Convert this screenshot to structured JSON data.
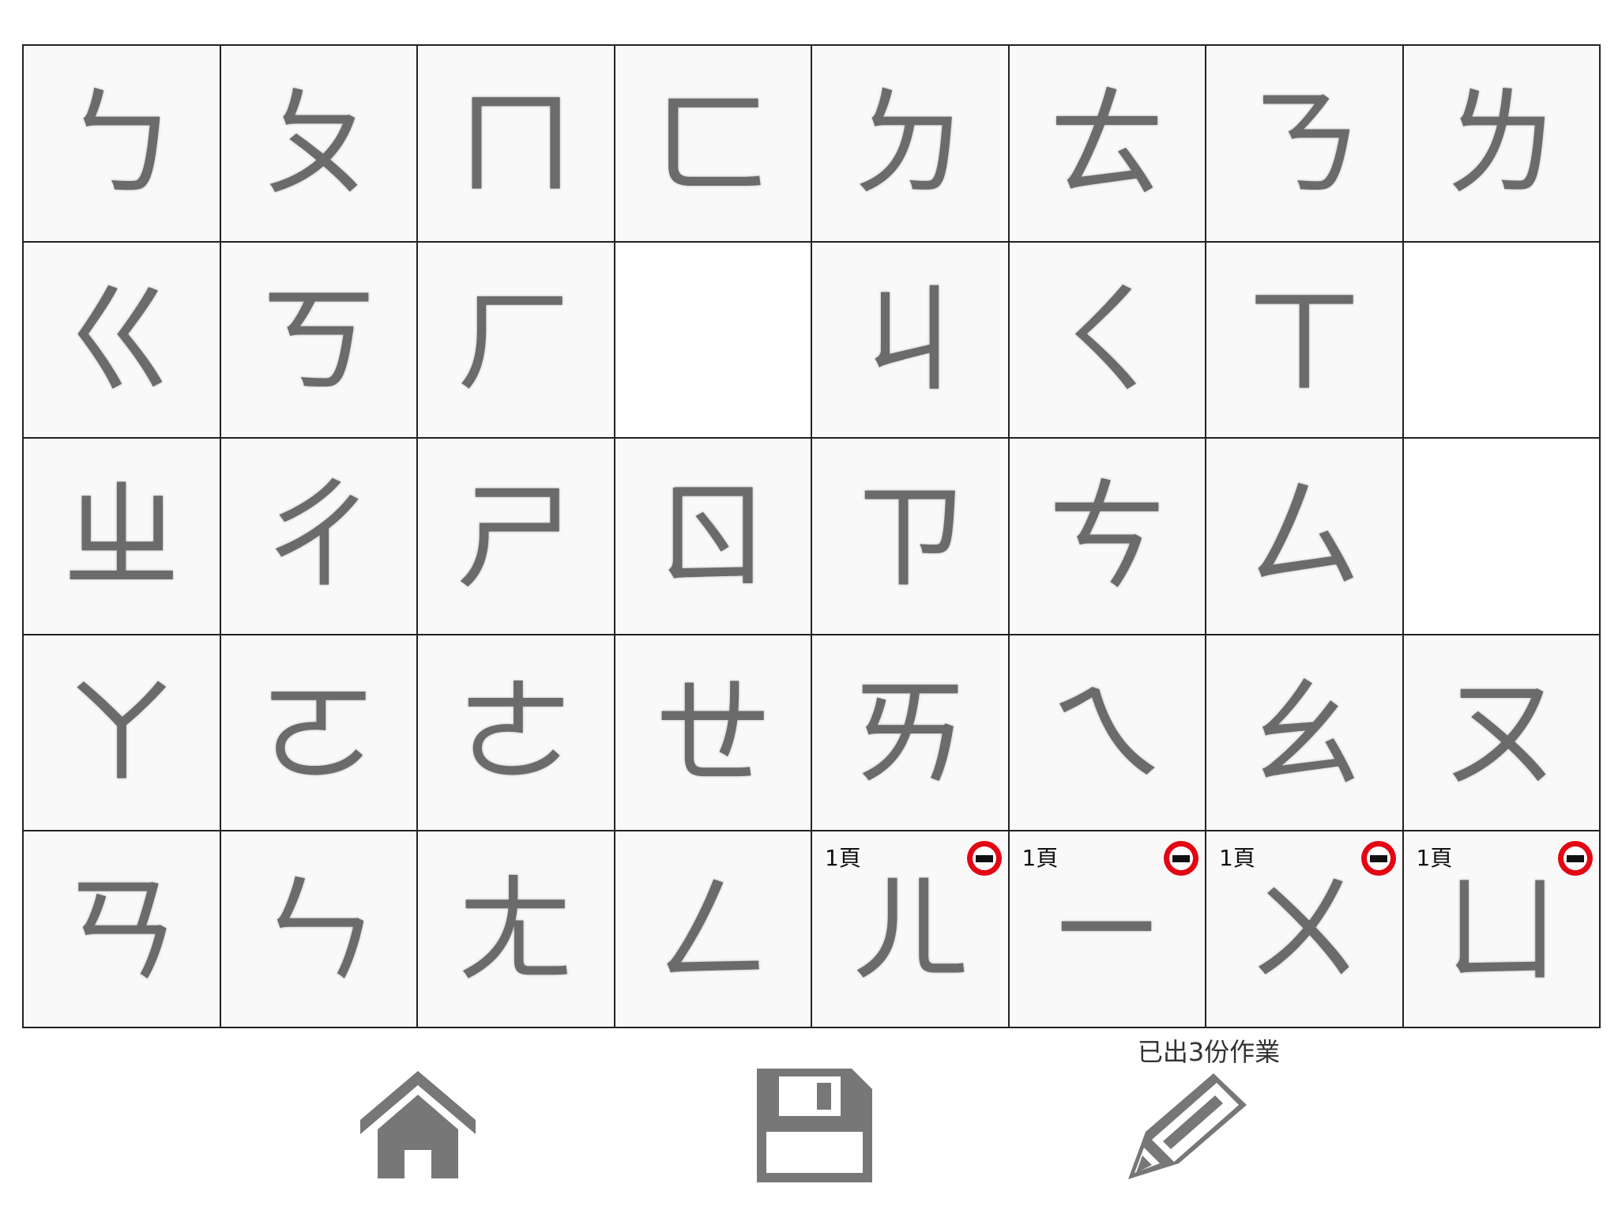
{
  "grid": {
    "rows": [
      [
        {
          "symbol": "ㄅ"
        },
        {
          "symbol": "ㄆ"
        },
        {
          "symbol": "ㄇ"
        },
        {
          "symbol": "ㄈ"
        },
        {
          "symbol": "ㄉ"
        },
        {
          "symbol": "ㄊ"
        },
        {
          "symbol": "ㄋ"
        },
        {
          "symbol": "ㄌ"
        }
      ],
      [
        {
          "symbol": "ㄍ"
        },
        {
          "symbol": "ㄎ"
        },
        {
          "symbol": "ㄏ"
        },
        {
          "symbol": ""
        },
        {
          "symbol": "ㄐ"
        },
        {
          "symbol": "ㄑ"
        },
        {
          "symbol": "ㄒ"
        },
        {
          "symbol": ""
        }
      ],
      [
        {
          "symbol": "ㄓ"
        },
        {
          "symbol": "ㄔ"
        },
        {
          "symbol": "ㄕ"
        },
        {
          "symbol": "ㄖ"
        },
        {
          "symbol": "ㄗ"
        },
        {
          "symbol": "ㄘ"
        },
        {
          "symbol": "ㄙ"
        },
        {
          "symbol": ""
        }
      ],
      [
        {
          "symbol": "ㄚ"
        },
        {
          "symbol": "ㄛ"
        },
        {
          "symbol": "ㄜ"
        },
        {
          "symbol": "ㄝ"
        },
        {
          "symbol": "ㄞ"
        },
        {
          "symbol": "ㄟ"
        },
        {
          "symbol": "ㄠ"
        },
        {
          "symbol": "ㄡ"
        }
      ],
      [
        {
          "symbol": "ㄢ"
        },
        {
          "symbol": "ㄣ"
        },
        {
          "symbol": "ㄤ"
        },
        {
          "symbol": "ㄥ"
        },
        {
          "symbol": "ㄦ",
          "pages": "1頁",
          "removable": true
        },
        {
          "symbol": "ㄧ",
          "pages": "1頁",
          "removable": true
        },
        {
          "symbol": "ㄨ",
          "pages": "1頁",
          "removable": true
        },
        {
          "symbol": "ㄩ",
          "pages": "1頁",
          "removable": true
        }
      ]
    ]
  },
  "toolbar": {
    "home_icon": "home-icon",
    "save_icon": "floppy-disk-icon",
    "assign_icon": "pencil-icon",
    "assign_label": "已出3份作業"
  },
  "colors": {
    "symbol": "#6b6b6b",
    "icon": "#777777",
    "remove": "#e30613",
    "grid_line": "#222222"
  }
}
